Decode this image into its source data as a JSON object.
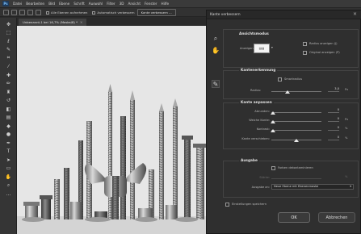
{
  "app": {
    "logo": "Ps"
  },
  "menu": [
    "Datei",
    "Bearbeiten",
    "Bild",
    "Ebene",
    "Schrift",
    "Auswahl",
    "Filter",
    "3D",
    "Ansicht",
    "Fenster",
    "Hilfe"
  ],
  "options": {
    "checkbox_label": "Alle Ebenen aufnehmen",
    "auto_label": "Automatisch verbessern",
    "button_label": "Kante verbessern ..."
  },
  "document": {
    "tab_title": "Unbenannt-1 bei 16,7% (Maske/8) *",
    "close": "×"
  },
  "tools": [
    {
      "name": "move-tool-icon",
      "glyph": "✥"
    },
    {
      "name": "marquee-tool-icon",
      "glyph": "⬚"
    },
    {
      "name": "lasso-tool-icon",
      "glyph": "ℓ"
    },
    {
      "name": "quick-select-tool-icon",
      "glyph": "✎"
    },
    {
      "name": "crop-tool-icon",
      "glyph": "⌗"
    },
    {
      "name": "eyedropper-tool-icon",
      "glyph": "⁄"
    },
    {
      "name": "healing-tool-icon",
      "glyph": "✚"
    },
    {
      "name": "brush-tool-icon",
      "glyph": "✏"
    },
    {
      "name": "stamp-tool-icon",
      "glyph": "♜"
    },
    {
      "name": "history-brush-tool-icon",
      "glyph": "↺"
    },
    {
      "name": "eraser-tool-icon",
      "glyph": "◧"
    },
    {
      "name": "gradient-tool-icon",
      "glyph": "▤"
    },
    {
      "name": "blur-tool-icon",
      "glyph": "◆"
    },
    {
      "name": "dodge-tool-icon",
      "glyph": "●"
    },
    {
      "name": "pen-tool-icon",
      "glyph": "✒"
    },
    {
      "name": "type-tool-icon",
      "glyph": "T"
    },
    {
      "name": "path-select-tool-icon",
      "glyph": "➤"
    },
    {
      "name": "shape-tool-icon",
      "glyph": "▭"
    },
    {
      "name": "hand-tool-icon",
      "glyph": "✋"
    },
    {
      "name": "zoom-tool-icon",
      "glyph": "⌕"
    },
    {
      "name": "more-tools-icon",
      "glyph": "…"
    }
  ],
  "dialog": {
    "title": "Kante verbessern",
    "close": "×",
    "view_mode": {
      "title": "Ansichtsmodus",
      "view_label": "Anzeigen:",
      "show_radius": "Radius anzeigen (J)",
      "show_original": "Original anzeigen (P)"
    },
    "edge_detection": {
      "title": "Kantenerkennung",
      "smart_radius": "Smartradius",
      "radius_label": "Radius:",
      "radius_value": "3,0",
      "radius_unit": "Px"
    },
    "adjust_edge": {
      "title": "Kante anpassen",
      "rows": [
        {
          "label": "Abrunden:",
          "value": "0",
          "unit": ""
        },
        {
          "label": "Weiche Kante:",
          "value": "0",
          "unit": "Px"
        },
        {
          "label": "Kontrast:",
          "value": "0",
          "unit": "%"
        },
        {
          "label": "Kante verschieben:",
          "value": "0",
          "unit": "%"
        }
      ]
    },
    "output": {
      "title": "Ausgabe",
      "decontaminate": "Farben dekontaminieren",
      "amount_label": "Stärke:",
      "amount_unit": "%",
      "output_to_label": "Ausgabe an:",
      "output_to_value": "Neue Ebene mit Ebenenmaske"
    },
    "remember": "Einstellungen speichern",
    "ok": "OK",
    "cancel": "Abbrechen"
  }
}
